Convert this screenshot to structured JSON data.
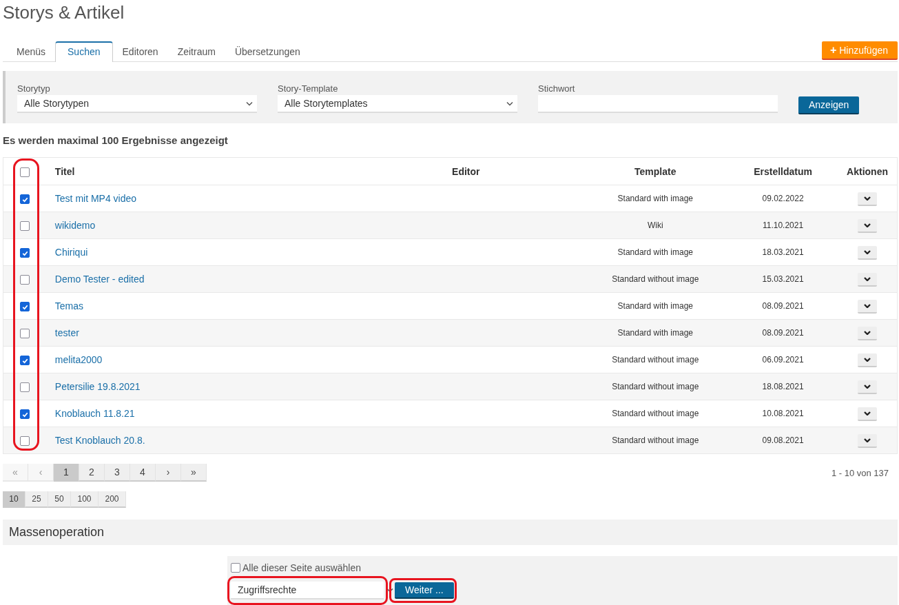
{
  "page_title": "Storys & Artikel",
  "tabs": [
    {
      "label": "Menüs",
      "selected": false
    },
    {
      "label": "Suchen",
      "selected": true
    },
    {
      "label": "Editoren",
      "selected": false
    },
    {
      "label": "Zeitraum",
      "selected": false
    },
    {
      "label": "Übersetzungen",
      "selected": false
    }
  ],
  "add_button": {
    "icon": "+",
    "label": "Hinzufügen"
  },
  "filters": [
    {
      "kind": "select",
      "label": "Storytyp",
      "value": "Alle Storytypen"
    },
    {
      "kind": "select",
      "label": "Story-Template",
      "value": "Alle Storytemplates"
    },
    {
      "kind": "text",
      "label": "Stichwort"
    }
  ],
  "show_button": "Anzeigen",
  "result_note": "Es werden maximal 100 Ergebnisse angezeigt",
  "table": {
    "checkbox_column_highlighted": true,
    "select_all_checked": false,
    "columns": [
      "Titel",
      "Editor",
      "Template",
      "Erstelldatum",
      "Aktionen"
    ],
    "rows": [
      {
        "checked": true,
        "title": "Test mit MP4 video",
        "template": "Standard with image",
        "date": "09.02.2022"
      },
      {
        "checked": false,
        "title": "wikidemo",
        "template": "Wiki",
        "date": "11.10.2021"
      },
      {
        "checked": true,
        "title": "Chiriqui",
        "template": "Standard with image",
        "date": "18.03.2021"
      },
      {
        "checked": false,
        "title": "Demo Tester - edited",
        "template": "Standard without image",
        "date": "15.03.2021"
      },
      {
        "checked": true,
        "title": "Temas",
        "template": "Standard with image",
        "date": "08.09.2021"
      },
      {
        "checked": false,
        "title": "tester",
        "template": "Standard with image",
        "date": "08.09.2021"
      },
      {
        "checked": true,
        "title": "melita2000",
        "template": "Standard without image",
        "date": "06.09.2021"
      },
      {
        "checked": false,
        "title": "Petersilie 19.8.2021",
        "template": "Standard without image",
        "date": "18.08.2021"
      },
      {
        "checked": true,
        "title": "Knoblauch 11.8.21",
        "template": "Standard without image",
        "date": "10.08.2021"
      },
      {
        "checked": false,
        "title": "Test Knoblauch 20.8.",
        "template": "Standard without image",
        "date": "09.08.2021"
      }
    ]
  },
  "pagination": [
    {
      "label": "«",
      "selected": false,
      "disabled": true
    },
    {
      "label": "‹",
      "selected": false,
      "disabled": true
    },
    {
      "label": "1",
      "selected": true,
      "disabled": false
    },
    {
      "label": "2",
      "selected": false,
      "disabled": false
    },
    {
      "label": "3",
      "selected": false,
      "disabled": false
    },
    {
      "label": "4",
      "selected": false,
      "disabled": false
    },
    {
      "label": "›",
      "selected": false,
      "disabled": false
    },
    {
      "label": "»",
      "selected": false,
      "disabled": false
    }
  ],
  "result_count": "1 - 10 von 137",
  "page_sizes": [
    {
      "label": "10",
      "selected": true
    },
    {
      "label": "25",
      "selected": false
    },
    {
      "label": "50",
      "selected": false
    },
    {
      "label": "100",
      "selected": false
    },
    {
      "label": "200",
      "selected": false
    }
  ],
  "mass_operation": {
    "title": "Massenoperation",
    "select_all": {
      "label": "Alle dieser Seite auswählen",
      "checked": false
    },
    "action": {
      "value": "Zugriffsrechte",
      "highlighted": true
    },
    "continue_button": {
      "label": "Weiter ...",
      "highlighted": true
    }
  }
}
